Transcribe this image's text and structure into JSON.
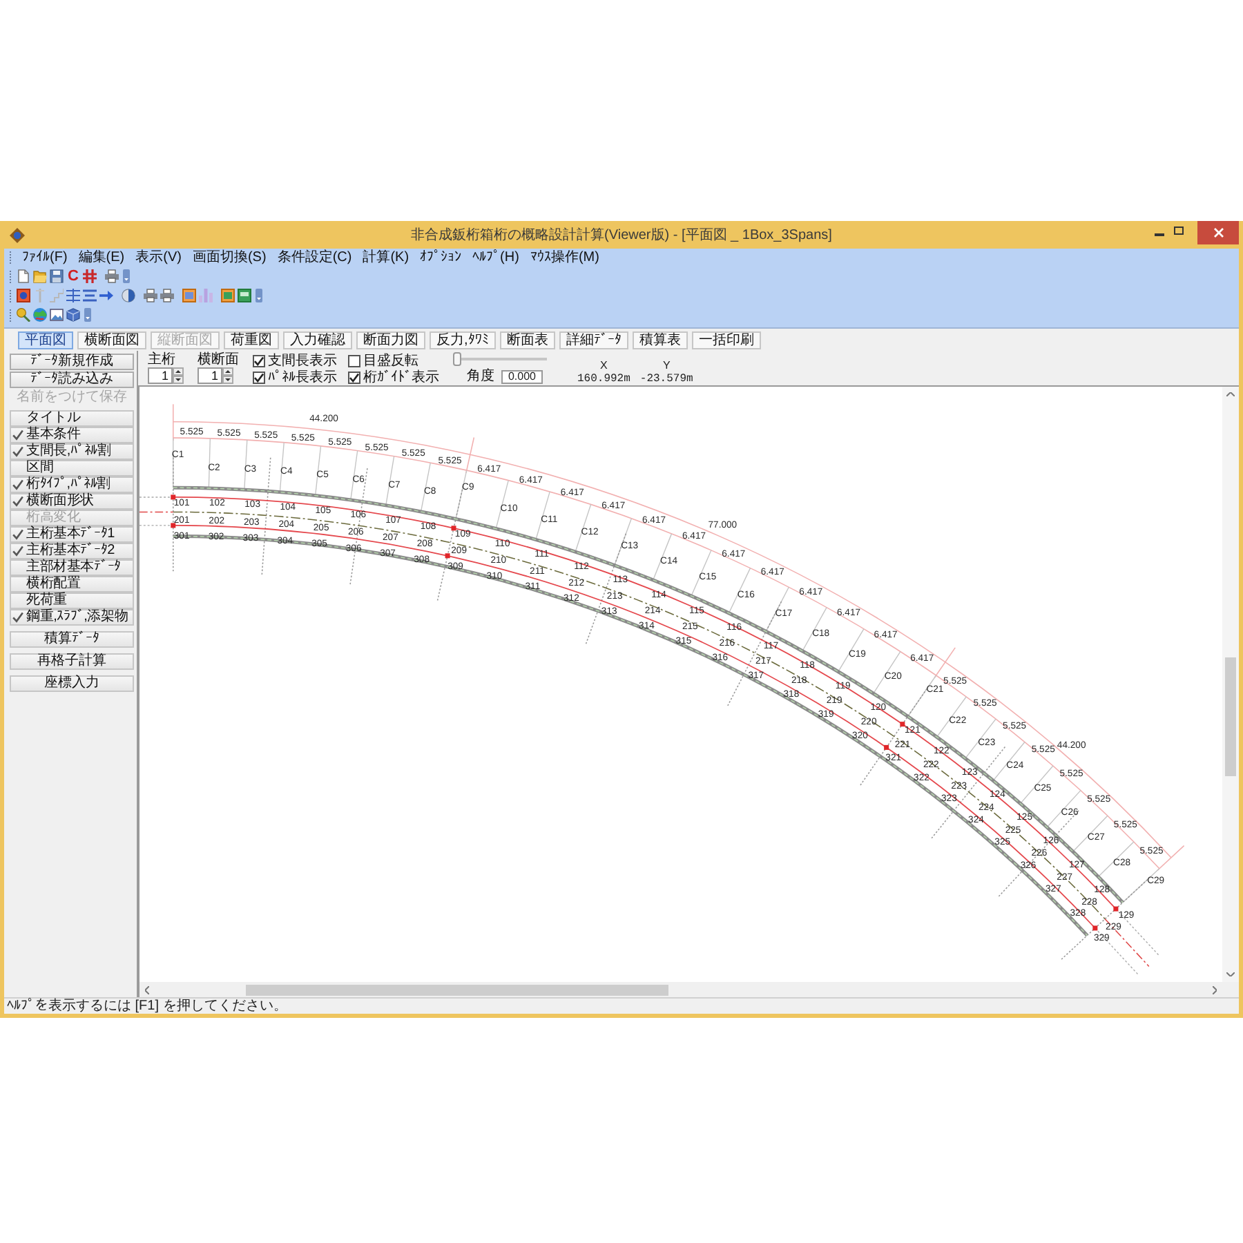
{
  "window": {
    "title": "非合成鈑桁箱桁の概略設計計算(Viewer版) - [平面図 _ 1Box_3Spans]"
  },
  "menu": [
    "ﾌｧｲﾙ(F)",
    "編集(E)",
    "表示(V)",
    "画面切換(S)",
    "条件設定(C)",
    "計算(K)",
    "ｵﾌﾟｼｮﾝ",
    "ﾍﾙﾌﾟ(H)",
    "ﾏｳｽ操作(M)"
  ],
  "toolbar": {
    "letter_button": "C"
  },
  "view_tabs": [
    {
      "label": "平面図",
      "selected": true,
      "disabled": false
    },
    {
      "label": "横断面図",
      "selected": false,
      "disabled": false
    },
    {
      "label": "縦断面図",
      "selected": false,
      "disabled": true
    },
    {
      "label": "荷重図",
      "selected": false,
      "disabled": false
    },
    {
      "label": "入力確認",
      "selected": false,
      "disabled": false
    },
    {
      "label": "断面力図",
      "selected": false,
      "disabled": false
    },
    {
      "label": "反力,ﾀﾜﾐ",
      "selected": false,
      "disabled": false
    },
    {
      "label": "断面表",
      "selected": false,
      "disabled": false
    },
    {
      "label": "詳細ﾃﾞｰﾀ",
      "selected": false,
      "disabled": false
    },
    {
      "label": "積算表",
      "selected": false,
      "disabled": false
    },
    {
      "label": "一括印刷",
      "selected": false,
      "disabled": false
    }
  ],
  "sidebar": {
    "file_buttons": [
      {
        "label": "ﾃﾞｰﾀ新規作成",
        "disabled": false
      },
      {
        "label": "ﾃﾞｰﾀ読み込み",
        "disabled": false
      },
      {
        "label": "名前をつけて保存",
        "disabled": true
      }
    ],
    "items": [
      {
        "label": "タイトル",
        "checked": false,
        "disabled": false
      },
      {
        "label": "基本条件",
        "checked": true,
        "disabled": false
      },
      {
        "label": "支間長,ﾊﾟﾈﾙ割",
        "checked": true,
        "disabled": false
      },
      {
        "label": "区間",
        "checked": false,
        "disabled": false
      },
      {
        "label": "桁ﾀｲﾌﾟ,ﾊﾟﾈﾙ割",
        "checked": true,
        "disabled": false
      },
      {
        "label": "横断面形状",
        "checked": true,
        "disabled": false
      },
      {
        "label": "桁高変化",
        "checked": false,
        "disabled": true
      },
      {
        "label": "主桁基本ﾃﾞｰﾀ1",
        "checked": true,
        "disabled": false
      },
      {
        "label": "主桁基本ﾃﾞｰﾀ2",
        "checked": true,
        "disabled": false
      },
      {
        "label": "主部材基本ﾃﾞｰﾀ",
        "checked": false,
        "disabled": false
      },
      {
        "label": "横桁配置",
        "checked": false,
        "disabled": false
      },
      {
        "label": "死荷重",
        "checked": false,
        "disabled": false
      },
      {
        "label": "鋼重,ｽﾗﾌﾞ,添架物",
        "checked": true,
        "disabled": false
      }
    ],
    "actions": [
      {
        "label": "積算ﾃﾞｰﾀ"
      },
      {
        "label": "再格子計算"
      },
      {
        "label": "座標入力"
      }
    ]
  },
  "controls": {
    "spinners": [
      {
        "label": "主桁",
        "value": "1"
      },
      {
        "label": "横断面",
        "value": "1"
      }
    ],
    "checkboxes": [
      {
        "label": "支間長表示",
        "checked": true
      },
      {
        "label": "目盛反転",
        "checked": false
      },
      {
        "label": "ﾊﾟﾈﾙ長表示",
        "checked": true
      },
      {
        "label": "桁ｶﾞｲﾄﾞ表示",
        "checked": true
      }
    ],
    "slider": {
      "level": 0
    },
    "angle": {
      "label": "角度",
      "value": "0.000"
    },
    "coordinates": [
      {
        "label": "X",
        "value": "160.992m"
      },
      {
        "label": "Y",
        "value": "-23.579m"
      }
    ]
  },
  "plan": {
    "span_lengths": [
      "44.200",
      "77.000",
      "44.200"
    ],
    "panel_lengths": [
      "5.525",
      "5.525",
      "5.525",
      "5.525",
      "5.525",
      "5.525",
      "5.525",
      "5.525",
      "6.417",
      "6.417",
      "6.417",
      "6.417",
      "6.417",
      "6.417",
      "6.417",
      "6.417",
      "6.417",
      "6.417",
      "6.417",
      "6.417",
      "5.525",
      "5.525",
      "5.525",
      "5.525",
      "5.525",
      "5.525",
      "5.525",
      "5.525"
    ],
    "cross_beams": [
      {
        "label": "C1",
        "kind": "support"
      },
      {
        "label": "C2",
        "kind": "panel"
      },
      {
        "label": "C3",
        "kind": "panel"
      },
      {
        "label": "C4",
        "kind": "panel"
      },
      {
        "label": "C5",
        "kind": "panel"
      },
      {
        "label": "C6",
        "kind": "panel"
      },
      {
        "label": "C7",
        "kind": "panel"
      },
      {
        "label": "C8",
        "kind": "panel"
      },
      {
        "label": "C9",
        "kind": "support"
      },
      {
        "label": "C10",
        "kind": "panel"
      },
      {
        "label": "C11",
        "kind": "panel"
      },
      {
        "label": "C12",
        "kind": "panel"
      },
      {
        "label": "C13",
        "kind": "panel"
      },
      {
        "label": "C14",
        "kind": "panel"
      },
      {
        "label": "C15",
        "kind": "panel"
      },
      {
        "label": "C16",
        "kind": "panel"
      },
      {
        "label": "C17",
        "kind": "panel"
      },
      {
        "label": "C18",
        "kind": "panel"
      },
      {
        "label": "C19",
        "kind": "panel"
      },
      {
        "label": "C20",
        "kind": "panel"
      },
      {
        "label": "C21",
        "kind": "support"
      },
      {
        "label": "C22",
        "kind": "panel"
      },
      {
        "label": "C23",
        "kind": "panel"
      },
      {
        "label": "C24",
        "kind": "panel"
      },
      {
        "label": "C25",
        "kind": "panel"
      },
      {
        "label": "C26",
        "kind": "panel"
      },
      {
        "label": "C27",
        "kind": "panel"
      },
      {
        "label": "C28",
        "kind": "panel"
      },
      {
        "label": "C29",
        "kind": "support"
      }
    ],
    "girder_lines": [
      {
        "kind": "web",
        "nodes": [
          "101",
          "102",
          "103",
          "104",
          "105",
          "106",
          "107",
          "108",
          "109",
          "110",
          "111",
          "112",
          "113",
          "114",
          "115",
          "116",
          "117",
          "118",
          "119",
          "120",
          "121",
          "122",
          "123",
          "124",
          "125",
          "126",
          "127",
          "128",
          "129"
        ]
      },
      {
        "kind": "center",
        "nodes": [
          "201",
          "202",
          "203",
          "204",
          "205",
          "206",
          "207",
          "208",
          "209",
          "210",
          "211",
          "212",
          "213",
          "214",
          "215",
          "216",
          "217",
          "218",
          "219",
          "220",
          "221",
          "222",
          "223",
          "224",
          "225",
          "226",
          "227",
          "228",
          "229"
        ]
      },
      {
        "kind": "web",
        "nodes": [
          "301",
          "302",
          "303",
          "304",
          "305",
          "306",
          "307",
          "308",
          "309",
          "310",
          "311",
          "312",
          "313",
          "314",
          "315",
          "316",
          "317",
          "318",
          "319",
          "320",
          "321",
          "322",
          "323",
          "324",
          "325",
          "326",
          "327",
          "328",
          "329"
        ]
      }
    ]
  },
  "status_bar": {
    "text": "ﾍﾙﾌﾟを表示するには [F1] を押してください。"
  }
}
